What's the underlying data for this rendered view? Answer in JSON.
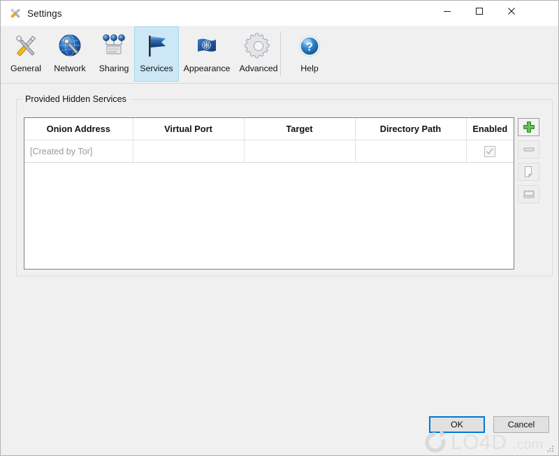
{
  "window": {
    "title": "Settings",
    "title_icon": "tools-icon",
    "controls": {
      "minimize": "minimize-icon",
      "maximize": "maximize-icon",
      "close": "close-icon"
    }
  },
  "toolbar": {
    "items": [
      {
        "label": "General",
        "icon": "tools-icon",
        "selected": false
      },
      {
        "label": "Network",
        "icon": "globe-wrench-icon",
        "selected": false
      },
      {
        "label": "Sharing",
        "icon": "network-share-icon",
        "selected": false
      },
      {
        "label": "Services",
        "icon": "flag-icon",
        "selected": true
      },
      {
        "label": "Appearance",
        "icon": "un-flag-icon",
        "selected": false
      },
      {
        "label": "Advanced",
        "icon": "gear-icon",
        "selected": false
      },
      {
        "label": "Help",
        "icon": "help-icon",
        "selected": false
      }
    ]
  },
  "group": {
    "title": "Provided Hidden Services"
  },
  "table": {
    "columns": [
      "Onion Address",
      "Virtual Port",
      "Target",
      "Directory Path",
      "Enabled"
    ],
    "rows": [
      {
        "onion_address": "[Created by Tor]",
        "virtual_port": "",
        "target": "",
        "directory_path": "",
        "enabled": true
      }
    ]
  },
  "side_buttons": [
    {
      "name": "add-service-button",
      "icon": "plus-icon",
      "enabled": true
    },
    {
      "name": "remove-service-button",
      "icon": "minus-icon",
      "enabled": false
    },
    {
      "name": "copy-button",
      "icon": "copy-icon",
      "enabled": false
    },
    {
      "name": "browse-button",
      "icon": "folder-icon",
      "enabled": false
    }
  ],
  "footer": {
    "ok_label": "OK",
    "cancel_label": "Cancel"
  },
  "watermark": {
    "text": "LO4D",
    "suffix": ".com"
  },
  "colors": {
    "accent": "#0078d7",
    "selected_tab_bg": "#cce8f7",
    "selected_tab_border": "#a6d8f0",
    "window_bg": "#f0f0f0",
    "table_border": "#7a7f8c",
    "placeholder_text": "#9a9a9a",
    "add_icon_green": "#4caf3f"
  }
}
